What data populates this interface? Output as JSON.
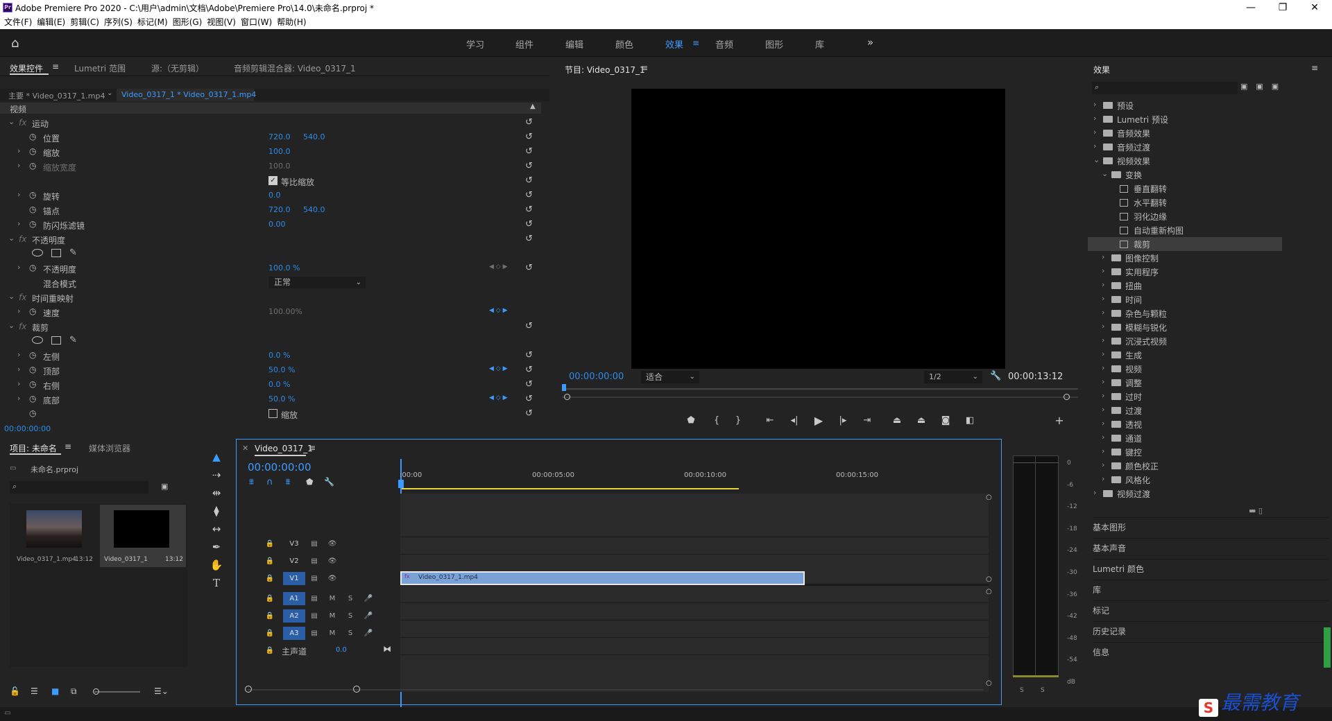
{
  "app": {
    "title": "Adobe Premiere Pro 2020 - C:\\用户\\admin\\文档\\Adobe\\Premiere Pro\\14.0\\未命名.prproj *",
    "logo": "Pr"
  },
  "menu": [
    "文件(F)",
    "编辑(E)",
    "剪辑(C)",
    "序列(S)",
    "标记(M)",
    "图形(G)",
    "视图(V)",
    "窗口(W)",
    "帮助(H)"
  ],
  "workspaces": [
    "学习",
    "组件",
    "编辑",
    "颜色",
    "效果",
    "音频",
    "图形",
    "库"
  ],
  "active_workspace": "效果",
  "effect_controls": {
    "tabs": [
      "效果控件",
      "Lumetri 范围",
      "源:（无剪辑）",
      "音频剪辑混合器: Video_0317_1"
    ],
    "master_clip": "主要 * Video_0317_1.mp4",
    "seq_clip": "Video_0317_1 * Video_0317_1.mp4",
    "section": "视频",
    "timecode": "00:00:00:00",
    "motion": "运动",
    "position": "位置",
    "position_x": "720.0",
    "position_y": "540.0",
    "scale": "缩放",
    "scale_v": "100.0",
    "scale_width": "缩放宽度",
    "scale_width_v": "100.0",
    "uniform_scale": "等比缩放",
    "rotation": "旋转",
    "rotation_v": "0.0",
    "anchor": "锚点",
    "anchor_x": "720.0",
    "anchor_y": "540.0",
    "antiflicker": "防闪烁滤镜",
    "antiflicker_v": "0.00",
    "opacity": "不透明度",
    "opacity_p": "不透明度",
    "opacity_v": "100.0 %",
    "blend": "混合模式",
    "blend_v": "正常",
    "time_remap": "时间重映射",
    "speed": "速度",
    "speed_v": "100.00%",
    "crop": "裁剪",
    "left": "左侧",
    "left_v": "0.0 %",
    "top": "顶部",
    "top_v": "50.0 %",
    "right": "右侧",
    "right_v": "0.0 %",
    "bottom": "底部",
    "bottom_v": "50.0 %",
    "zoom": "缩放"
  },
  "program": {
    "title": "节目: Video_0317_1",
    "timecode": "00:00:00:00",
    "fit": "适合",
    "quality": "1/2",
    "duration": "00:00:13:12"
  },
  "effects": {
    "title": "效果",
    "items": [
      {
        "label": "预设",
        "level": 0,
        "type": "folder"
      },
      {
        "label": "Lumetri 预设",
        "level": 0,
        "type": "folder"
      },
      {
        "label": "音频效果",
        "level": 0,
        "type": "folder"
      },
      {
        "label": "音频过渡",
        "level": 0,
        "type": "folder"
      },
      {
        "label": "视频效果",
        "level": 0,
        "type": "folder",
        "open": true
      },
      {
        "label": "变换",
        "level": 1,
        "type": "folder",
        "open": true
      },
      {
        "label": "垂直翻转",
        "level": 2,
        "type": "fx"
      },
      {
        "label": "水平翻转",
        "level": 2,
        "type": "fx"
      },
      {
        "label": "羽化边缘",
        "level": 2,
        "type": "fx"
      },
      {
        "label": "自动重新构图",
        "level": 2,
        "type": "fx"
      },
      {
        "label": "裁剪",
        "level": 2,
        "type": "fx",
        "selected": true
      },
      {
        "label": "图像控制",
        "level": 1,
        "type": "folder"
      },
      {
        "label": "实用程序",
        "level": 1,
        "type": "folder"
      },
      {
        "label": "扭曲",
        "level": 1,
        "type": "folder"
      },
      {
        "label": "时间",
        "level": 1,
        "type": "folder"
      },
      {
        "label": "杂色与颗粒",
        "level": 1,
        "type": "folder"
      },
      {
        "label": "模糊与锐化",
        "level": 1,
        "type": "folder"
      },
      {
        "label": "沉浸式视频",
        "level": 1,
        "type": "folder"
      },
      {
        "label": "生成",
        "level": 1,
        "type": "folder"
      },
      {
        "label": "视频",
        "level": 1,
        "type": "folder"
      },
      {
        "label": "调整",
        "level": 1,
        "type": "folder"
      },
      {
        "label": "过时",
        "level": 1,
        "type": "folder"
      },
      {
        "label": "过渡",
        "level": 1,
        "type": "folder"
      },
      {
        "label": "透视",
        "level": 1,
        "type": "folder"
      },
      {
        "label": "通道",
        "level": 1,
        "type": "folder"
      },
      {
        "label": "键控",
        "level": 1,
        "type": "folder"
      },
      {
        "label": "颜色校正",
        "level": 1,
        "type": "folder"
      },
      {
        "label": "风格化",
        "level": 1,
        "type": "folder"
      },
      {
        "label": "视频过渡",
        "level": 0,
        "type": "folder"
      }
    ],
    "side_panels": [
      "基本图形",
      "基本声音",
      "Lumetri 颜色",
      "库",
      "标记",
      "历史记录",
      "信息"
    ]
  },
  "project": {
    "tabs": [
      "项目: 未命名",
      "媒体浏览器"
    ],
    "file": "未命名.prproj",
    "items": [
      {
        "name": "Video_0317_1.mp4",
        "dur": "13:12"
      },
      {
        "name": "Video_0317_1",
        "dur": "13:12"
      }
    ]
  },
  "timeline": {
    "title": "Video_0317_1",
    "timecode": "00:00:00:00",
    "ticks": [
      ":00:00",
      "00:00:05:00",
      "00:00:10:00",
      "00:00:15:00"
    ],
    "video_tracks": [
      "V3",
      "V2",
      "V1"
    ],
    "audio_tracks": [
      "A1",
      "A2",
      "A3"
    ],
    "master": "主声道",
    "master_v": "0.0",
    "clip": "Video_0317_1.mp4",
    "m": "M",
    "s": "S"
  },
  "meter": {
    "labels": [
      "0",
      "-6",
      "-12",
      "-18",
      "-24",
      "-30",
      "-36",
      "-42",
      "-48",
      "-54",
      "dB"
    ],
    "solo": [
      "S",
      "S"
    ]
  },
  "watermark": {
    "text": "最需教育",
    "colors": {
      "accent": "#3d9bff",
      "clip": "#7aa2d6",
      "selection": "#2d8ceb"
    }
  }
}
